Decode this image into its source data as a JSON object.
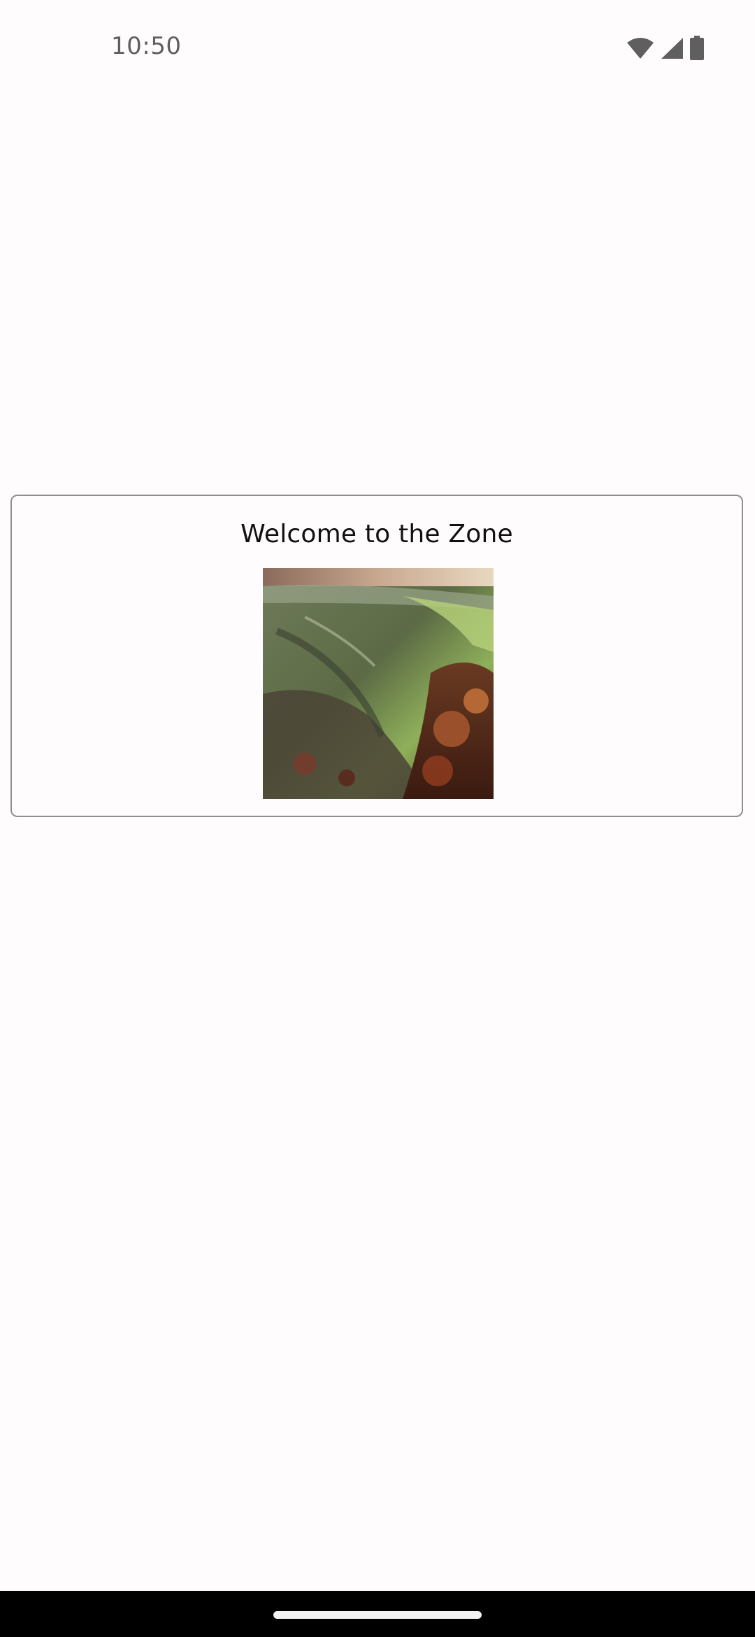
{
  "status_bar": {
    "time": "10:50",
    "icons": [
      "wifi-icon",
      "cellular-signal-icon",
      "battery-icon"
    ]
  },
  "card": {
    "title": "Welcome to the Zone"
  },
  "colors": {
    "background": "#fefcfc",
    "card_border": "#8f8f8f",
    "nav_bar": "#000000"
  }
}
